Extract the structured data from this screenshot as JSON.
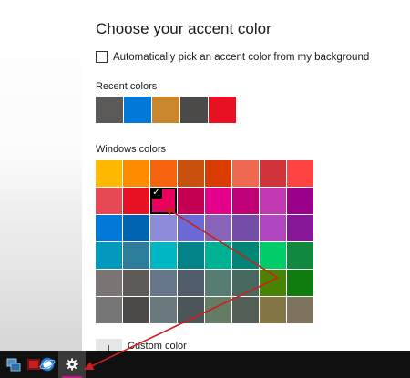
{
  "settings": {
    "title": "Choose your accent color",
    "auto_pick_label": "Automatically pick an accent color from my background",
    "recent_label": "Recent colors",
    "windows_label": "Windows colors",
    "custom_label": "Custom color"
  },
  "recent_colors": [
    "#5c5a58",
    "#0078d7",
    "#ca862d",
    "#4c4a48",
    "#e81123"
  ],
  "windows_colors": [
    "#ffb900",
    "#ff8c00",
    "#f7630c",
    "#ca5010",
    "#da3b01",
    "#ef6950",
    "#d13438",
    "#ff4343",
    "#e74856",
    "#e81123",
    "#ea005e",
    "#c30052",
    "#e3008c",
    "#bf0077",
    "#c239b3",
    "#9a0089",
    "#0078d7",
    "#0063b1",
    "#8e8cd8",
    "#6b69d6",
    "#8764b8",
    "#744da9",
    "#b146c2",
    "#881798",
    "#0099bc",
    "#2d7d9a",
    "#00b7c3",
    "#038387",
    "#00b294",
    "#018574",
    "#00cc6a",
    "#10893e",
    "#7a7574",
    "#5d5a58",
    "#68768a",
    "#515c6b",
    "#567c73",
    "#486860",
    "#498205",
    "#107c10",
    "#767676",
    "#4c4a48",
    "#69797e",
    "#4a5459",
    "#647c64",
    "#525e54",
    "#847545",
    "#7e735f"
  ],
  "selected_index": 10,
  "taskbar": {
    "icons": [
      "network-icon",
      "red-app-icon",
      "browser-icon",
      "settings-gear-icon"
    ],
    "active_color": "#c71585"
  },
  "annotation_color": "#cc1f1f"
}
